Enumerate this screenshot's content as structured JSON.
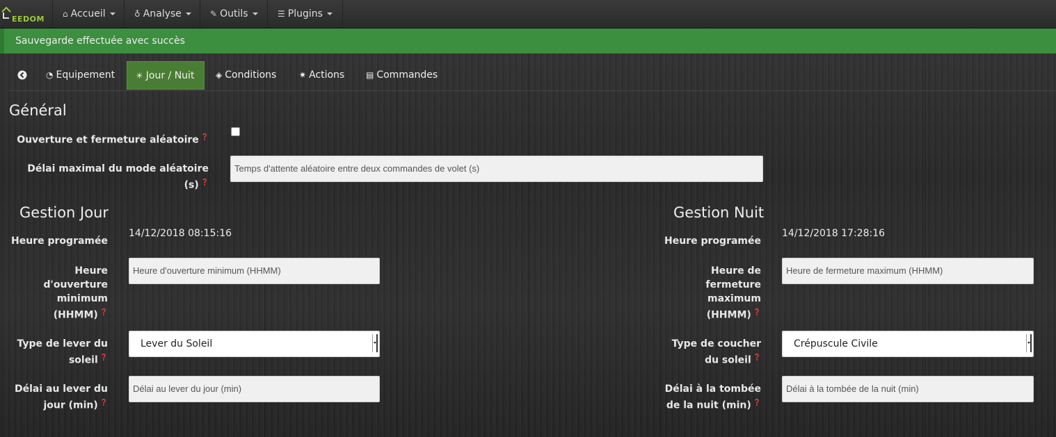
{
  "brand": {
    "text": "EEDOM",
    "logo_icon": "jeedom-house-icon",
    "accent": "#9ccc3a"
  },
  "nav": [
    {
      "label": "Accueil",
      "icon": "home-icon"
    },
    {
      "label": "Analyse",
      "icon": "stethoscope-icon"
    },
    {
      "label": "Outils",
      "icon": "wrench-icon"
    },
    {
      "label": "Plugins",
      "icon": "tasks-icon"
    }
  ],
  "alert": {
    "text": "Sauvegarde effectuée avec succès",
    "color": "#3b8f3f"
  },
  "tabs": [
    {
      "label": "",
      "icon": "back-arrow-icon"
    },
    {
      "label": "Equipement",
      "icon": "tachometer-icon"
    },
    {
      "label": "Jour / Nuit",
      "icon": "sun-icon",
      "active": true
    },
    {
      "label": "Conditions",
      "icon": "cube-icon"
    },
    {
      "label": "Actions",
      "icon": "cog-icon"
    },
    {
      "label": "Commandes",
      "icon": "list-icon"
    }
  ],
  "general": {
    "title": "Général",
    "random_label": "Ouverture et fermeture aléatoire",
    "random_checked": false,
    "delay_label": "Délai maximal du mode aléatoire (s)",
    "delay_placeholder": "Temps d'attente aléatoire entre deux commandes de volet (s)"
  },
  "jour": {
    "title": "Gestion Jour",
    "scheduled_label": "Heure programée",
    "scheduled_value": "14/12/2018 08:15:16",
    "min_open_label_1": "Heure",
    "min_open_label_2": "d'ouverture",
    "min_open_label_3": "minimum",
    "min_open_label_4": "(HHMM)",
    "min_open_placeholder": "Heure d'ouverture minimum (HHMM)",
    "sunrise_type_label_1": "Type de lever du",
    "sunrise_type_label_2": "soleil",
    "sunrise_type_value": "Lever du Soleil",
    "delay_label_1": "Délai au lever du",
    "delay_label_2": "jour (min)",
    "delay_placeholder": "Délai au lever du jour (min)"
  },
  "nuit": {
    "title": "Gestion Nuit",
    "scheduled_label": "Heure programée",
    "scheduled_value": "14/12/2018 17:28:16",
    "max_close_label_1": "Heure de",
    "max_close_label_2": "fermeture",
    "max_close_label_3": "maximum",
    "max_close_label_4": "(HHMM)",
    "max_close_placeholder": "Heure de fermeture maximum (HHMM)",
    "sunset_type_label_1": "Type de coucher",
    "sunset_type_label_2": "du soleil",
    "sunset_type_value": "Crépuscule Civile",
    "delay_label_1": "Délai à la tombée",
    "delay_label_2": "de la nuit (min)",
    "delay_placeholder": "Délai à la tombée de la nuit (min)"
  }
}
